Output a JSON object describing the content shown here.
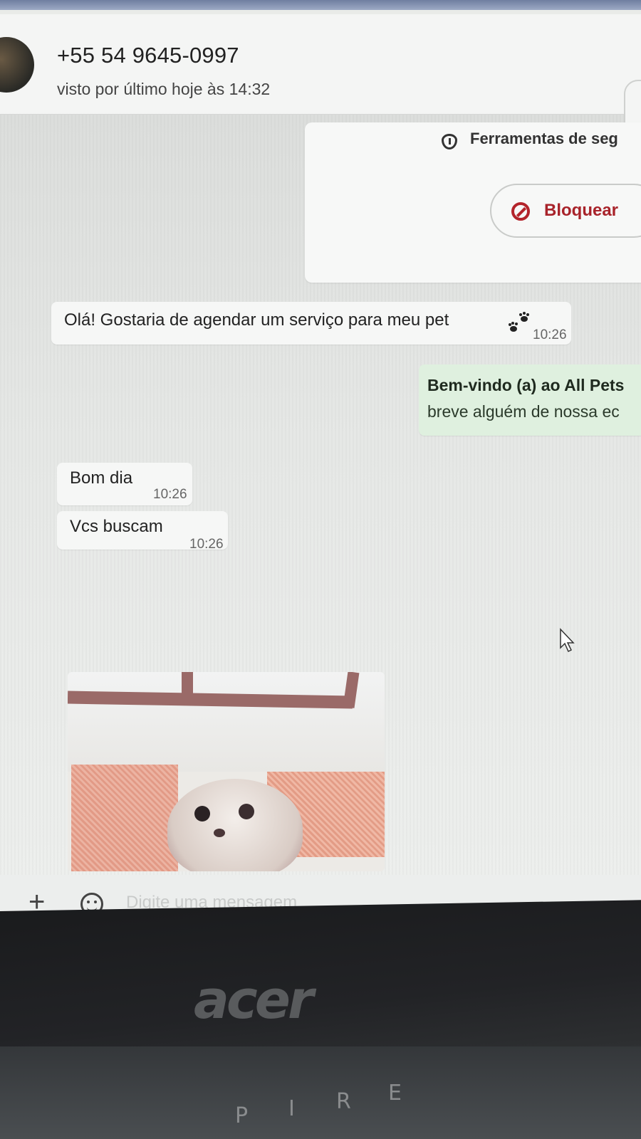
{
  "header": {
    "contact_name": "+55 54 9645-0997",
    "status": "visto por último hoje às 14:32"
  },
  "security_card": {
    "tools_label": "Ferramentas de seg",
    "block_label": "Bloquear",
    "accent_color": "#b3242b"
  },
  "messages": [
    {
      "text": "Olá! Gostaria de agendar um serviço para meu pet",
      "emoji": "paw-prints",
      "time": "10:26",
      "direction": "incoming"
    },
    {
      "line1": "Bem-vindo (a) ao All Pets",
      "line2": "breve alguém de nossa ec",
      "direction": "outgoing"
    },
    {
      "text": "Bom dia",
      "time": "10:26",
      "direction": "incoming"
    },
    {
      "text": "Vcs buscam",
      "time": "10:26",
      "direction": "incoming"
    },
    {
      "type": "image",
      "subject": "small white dog"
    }
  ],
  "composer": {
    "placeholder": "Digite uma mensagem"
  },
  "laptop": {
    "brand": "acer",
    "keys": [
      "P",
      "I",
      "R",
      "E"
    ]
  }
}
